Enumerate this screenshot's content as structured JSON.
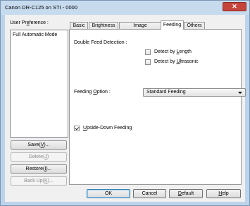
{
  "window": {
    "title": "Canon DR-C125 on STI - 0000",
    "close_glyph": "✕"
  },
  "user_preference": {
    "label_before": "User Pr",
    "label_mnemonic": "e",
    "label_after": "ference :",
    "items": [
      "Full Automatic Mode"
    ],
    "buttons": {
      "save": {
        "before": "Save(",
        "mnemonic": "V",
        "after": ")..."
      },
      "delete": {
        "before": "Delete(",
        "mnemonic": "J",
        "after": ")"
      },
      "restore": {
        "before": "Restore(",
        "mnemonic": "I",
        "after": ")..."
      },
      "backup": {
        "before": "Back Up(",
        "mnemonic": "K",
        "after": ")..."
      }
    }
  },
  "tabs": [
    "Basic",
    "Brightness",
    "Image processing",
    "Feeding",
    "Others"
  ],
  "active_tab": "Feeding",
  "feeding": {
    "double_feed_label": "Double Feed Detection :",
    "detect_length": {
      "before": "Detect by ",
      "mnemonic": "L",
      "after": "ength",
      "checked": false
    },
    "detect_ultrasonic": {
      "before": "Detect by ",
      "mnemonic": "U",
      "after": "ltrasonic",
      "checked": false
    },
    "feeding_option": {
      "before": "Feeding ",
      "mnemonic": "O",
      "after": "ption :",
      "value": "Standard Feeding"
    },
    "upside_down": {
      "before": "",
      "mnemonic": "U",
      "after": "pside-Down Feeding",
      "checked": true
    }
  },
  "dialog_buttons": {
    "ok": "OK",
    "cancel": "Cancel",
    "default": {
      "mnemonic": "D",
      "after": "efault"
    },
    "help": {
      "mnemonic": "H",
      "after": "elp"
    }
  }
}
